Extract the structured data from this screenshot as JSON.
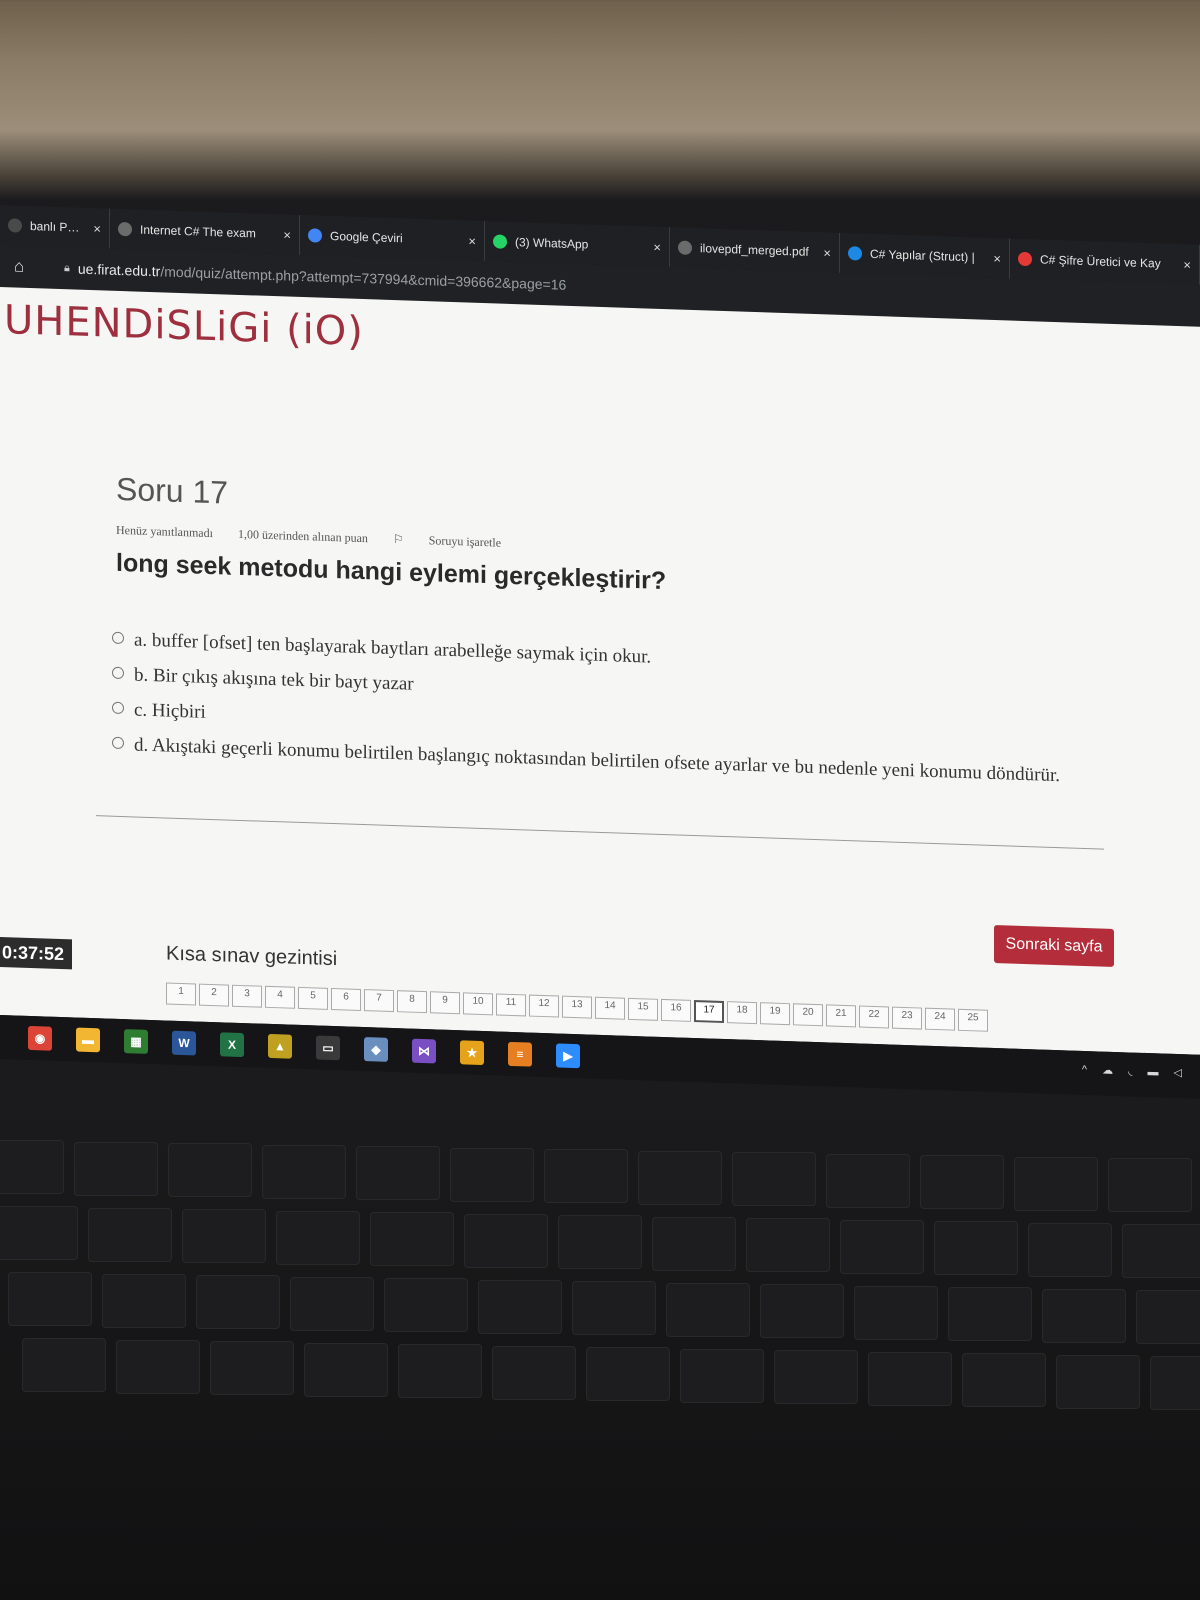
{
  "browser": {
    "tabs": [
      {
        "label": "banlı Progran",
        "icon": "page-icon",
        "color": "#4a4a4a"
      },
      {
        "label": "Internet C# The exam",
        "icon": "globe-icon",
        "color": "#6b6b6b"
      },
      {
        "label": "Google Çeviri",
        "icon": "google-translate-icon",
        "color": "#4285f4"
      },
      {
        "label": "(3) WhatsApp",
        "icon": "whatsapp-icon",
        "color": "#25d366"
      },
      {
        "label": "ilovepdf_merged.pdf",
        "icon": "globe-icon",
        "color": "#6b6b6b"
      },
      {
        "label": "C# Yapılar (Struct) |",
        "icon": "dash-icon",
        "color": "#1e88e5"
      },
      {
        "label": "C# Şifre Üretici ve Kay",
        "icon": "tool-icon",
        "color": "#e53935"
      }
    ],
    "close_glyph": "×",
    "mute_glyph": "◂ɪ",
    "url_host": "ue.firat.edu.tr",
    "url_path": "/mod/quiz/attempt.php?attempt=737994&cmid=396662&page=16"
  },
  "page": {
    "site_title": "UHENDiSLiGi (iO)",
    "question": {
      "number_label": "Soru 17",
      "status": "Henüz yanıtlanmadı",
      "points": "1,00 üzerinden alınan puan",
      "flag_label": "Soruyu işaretle",
      "text": "long seek metodu hangi eylemi gerçekleştirir?",
      "options": [
        {
          "label": "a. buffer [ofset] ten başlayarak baytları arabelleğe saymak için okur."
        },
        {
          "label": "b. Bir çıkış akışına tek bir bayt yazar"
        },
        {
          "label": "c. Hiçbiri"
        },
        {
          "label": "d. Akıştaki geçerli konumu belirtilen başlangıç noktasından belirtilen ofsete ayarlar ve bu nedenle yeni konumu döndürür."
        }
      ]
    },
    "next_button": "Sonraki sayfa",
    "nav_title": "Kısa sınav gezintisi",
    "timer": "0:37:52",
    "nav_pages": [
      "1",
      "2",
      "3",
      "4",
      "5",
      "6",
      "7",
      "8",
      "9",
      "10",
      "11",
      "12",
      "13",
      "14",
      "15",
      "16",
      "17",
      "18",
      "19",
      "20",
      "21",
      "22",
      "23",
      "24",
      "25"
    ],
    "current_page": "17"
  },
  "taskbar": {
    "icons": [
      {
        "name": "chrome-icon",
        "color": "#db4437",
        "glyph": "◉"
      },
      {
        "name": "file-explorer-icon",
        "color": "#f2b632",
        "glyph": "▬"
      },
      {
        "name": "app-grid-icon",
        "color": "#2e7d32",
        "glyph": "▦"
      },
      {
        "name": "word-icon",
        "color": "#2b579a",
        "glyph": "W"
      },
      {
        "name": "excel-icon",
        "color": "#217346",
        "glyph": "X"
      },
      {
        "name": "image-viewer-icon",
        "color": "#c0a020",
        "glyph": "▲"
      },
      {
        "name": "terminal-icon",
        "color": "#3a3a3a",
        "glyph": "▭"
      },
      {
        "name": "cube-icon",
        "color": "#6a8fbf",
        "glyph": "◆"
      },
      {
        "name": "visual-studio-icon",
        "color": "#7b4fc4",
        "glyph": "⋈"
      },
      {
        "name": "star-icon",
        "color": "#e6a21a",
        "glyph": "★"
      },
      {
        "name": "sublime-icon",
        "color": "#e67e22",
        "glyph": "≡"
      },
      {
        "name": "zoom-icon",
        "color": "#2d8cff",
        "glyph": "▶"
      }
    ],
    "tray": "^ ☁ ◟ ▬ ◁"
  }
}
